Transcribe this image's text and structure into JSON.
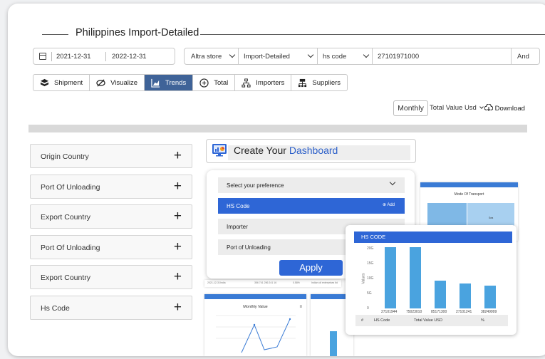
{
  "page": {
    "title": "Philippines Import-Detailed"
  },
  "filters": {
    "date_from": "2021-12-31",
    "date_to": "2022-12-31",
    "source": "Altra store",
    "dataset": "Import-Detailed",
    "field": "hs code",
    "query": "27101971000",
    "extra": "And"
  },
  "tabs": [
    {
      "label": "Shipment",
      "icon": "box-icon"
    },
    {
      "label": "Visualize",
      "icon": "eye-off-icon"
    },
    {
      "label": "Trends",
      "icon": "chart-icon",
      "active": true
    },
    {
      "label": "Total",
      "icon": "plus-circle-icon"
    },
    {
      "label": "Importers",
      "icon": "hierarchy-icon"
    },
    {
      "label": "Suppliers",
      "icon": "org-icon"
    }
  ],
  "controls": {
    "period": "Monthly",
    "metric": "Total Value Usd",
    "download": "Download"
  },
  "sidebar_filters": [
    "Origin Country",
    "Port Of Unloading",
    "Export Country",
    "Port Of Unloading",
    "Export Country",
    "Hs Code"
  ],
  "dashboard": {
    "title_prefix": "Create Your",
    "title_highlight": "Dashboard",
    "preference_heading": "Select your preference",
    "preferences": [
      "HS Code",
      "Importer",
      "Port of Unloading"
    ],
    "add_label": "Add",
    "apply_label": "Apply"
  },
  "thumbs": {
    "mode_header": "Mode of Transport",
    "mode_title": "Mode Of Transport",
    "mode_slice": "Sea",
    "monthly_header": "Month",
    "monthly_title": "Monthly Value",
    "hscode_header": "HS Code",
    "row_left": "India",
    "row_mid": "356 741 256 241 16",
    "row_right": "0.58%",
    "row_far": "Indian oil enterprises ltd"
  },
  "hs_chart": {
    "header": "HS CODE",
    "y_label": "Values",
    "y_ticks": [
      "20G",
      "15G",
      "10G",
      "5G",
      "0"
    ],
    "table_headers": [
      "#",
      "HS Code",
      "Total Value USD",
      "%"
    ]
  },
  "chart_data": {
    "type": "bar",
    "categories": [
      "27101944",
      "75023010",
      "85171300",
      "27101241",
      "38249999"
    ],
    "values": [
      20.5,
      20.4,
      9.4,
      8.4,
      7.6
    ],
    "ylabel": "Values",
    "ylim": [
      0,
      20
    ],
    "y_ticks": [
      "20G",
      "15G",
      "10G",
      "5G",
      "0"
    ],
    "grid": true
  }
}
